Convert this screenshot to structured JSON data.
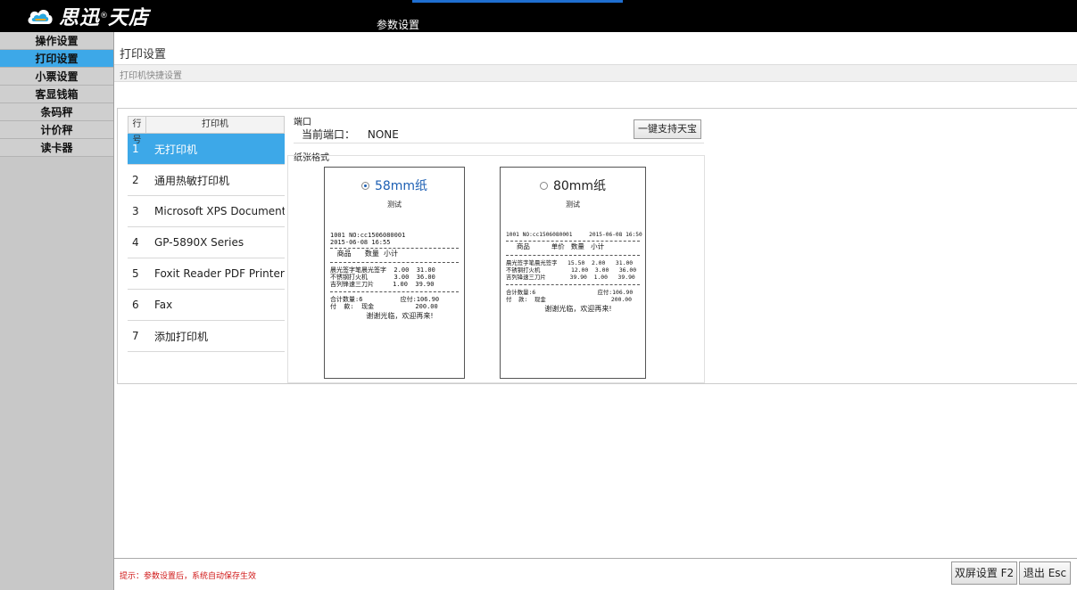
{
  "app": {
    "logo_text": "思迅",
    "logo_text2": "天店",
    "logo_reg": "®",
    "window_title": "参数设置"
  },
  "sidebar": {
    "items": [
      {
        "label": "操作设置",
        "active": false
      },
      {
        "label": "打印设置",
        "active": true
      },
      {
        "label": "小票设置",
        "active": false
      },
      {
        "label": "客显钱箱",
        "active": false
      },
      {
        "label": "条码秤",
        "active": false
      },
      {
        "label": "计价秤",
        "active": false
      },
      {
        "label": "读卡器",
        "active": false
      }
    ]
  },
  "main": {
    "title": "打印设置",
    "subbar": "打印机快捷设置"
  },
  "printers": {
    "header_no": "行号",
    "header_name": "打印机",
    "rows": [
      {
        "no": "1",
        "name": "无打印机",
        "selected": true
      },
      {
        "no": "2",
        "name": "通用热敏打印机",
        "selected": false
      },
      {
        "no": "3",
        "name": "Microsoft XPS Document ...",
        "selected": false
      },
      {
        "no": "4",
        "name": "GP-5890X Series",
        "selected": false
      },
      {
        "no": "5",
        "name": "Foxit Reader PDF Printer",
        "selected": false
      },
      {
        "no": "6",
        "name": "Fax",
        "selected": false
      },
      {
        "no": "7",
        "name": "添加打印机",
        "selected": false
      }
    ]
  },
  "port": {
    "label": "端口",
    "current_label": "当前端口：",
    "current_value": "NONE",
    "one_key_button": "一键支持天宝"
  },
  "paper": {
    "label": "纸张格式",
    "r58": {
      "label": "58mm纸",
      "checked": true,
      "test": "测试",
      "line1": "1001 NO:cc1506080001",
      "line2": "2015-06-08 16:55",
      "cols": "   商品      数量  小计",
      "items": "晨光签字笔晨光签字  2.00  31.00\n不锈钢打火机       3.00  36.00\n吉列锋速三刀片     1.00  39.90",
      "total": "合计数量:6          应付:106.90\n付  款:  现金           200.00",
      "thanks": "谢谢光临，欢迎再来!"
    },
    "r80": {
      "label": "80mm纸",
      "checked": false,
      "test": "测试",
      "line1": "1001 NO:cc1506080001     2015-06-08 16:50",
      "cols": "     商品          单价   数量   小计",
      "items": "晨光签字笔晨光签字   15.50  2.00   31.00\n不锈钢打火机         12.00  3.00   36.00\n吉列锋速三刀片       39.90  1.00   39.90",
      "total": "合计数量:6                  应付:106.90\n付  款:  现金                   200.00",
      "thanks": "谢谢光临，欢迎再来!"
    }
  },
  "footer": {
    "hint": "提示：参数设置后，系统自动保存生效",
    "dual_screen_button": "双屏设置 F2",
    "exit_button": "退出 Esc"
  },
  "colors": {
    "accent": "#3da8e8",
    "topbar": "#000000",
    "hint": "#d01818"
  }
}
